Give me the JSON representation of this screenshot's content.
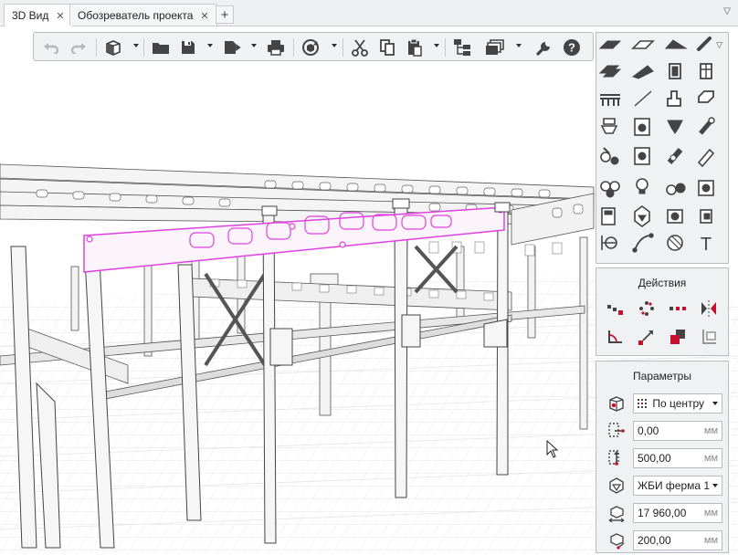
{
  "tabs": [
    {
      "label": "3D Вид",
      "active": true
    },
    {
      "label": "Обозреватель проекта",
      "active": false
    }
  ],
  "tab_add": "+",
  "tab_close": "✕",
  "tab_menu": "▽",
  "toolbar": {
    "buttons": [
      "undo-icon",
      "redo-icon",
      "view-cube-icon",
      "open-folder-icon",
      "save-icon",
      "export-icon",
      "print-icon",
      "render-icon",
      "cut-icon",
      "copy-icon",
      "paste-icon",
      "hierarchy-icon",
      "layers-icon",
      "settings-wrench-icon",
      "help-icon"
    ]
  },
  "actions_panel": {
    "title": "Действия"
  },
  "params_panel": {
    "title": "Параметры",
    "anchor": {
      "value": "По центру"
    },
    "offset": {
      "value": "0,00",
      "unit": "мм"
    },
    "height": {
      "value": "500,00",
      "unit": "мм"
    },
    "type": {
      "value": "ЖБИ ферма 1"
    },
    "length": {
      "value": "17 960,00",
      "unit": "мм"
    },
    "width": {
      "value": "200,00",
      "unit": "мм"
    }
  },
  "colors": {
    "selection": "#e040e0",
    "accent": "#c8102e",
    "panel_bg": "#f0f1f3"
  }
}
